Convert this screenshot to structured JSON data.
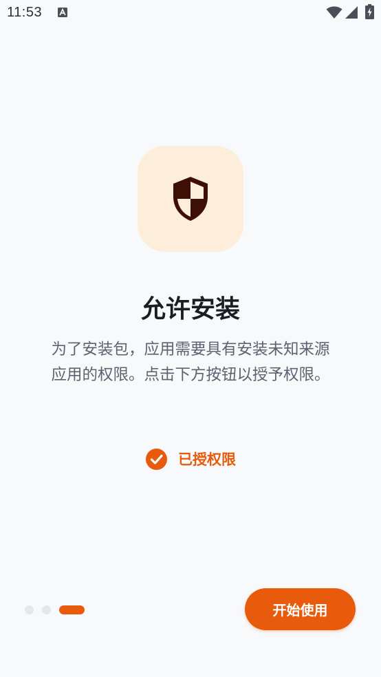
{
  "status_bar": {
    "time": "11:53",
    "icons": [
      "a-notification-icon",
      "wifi-icon",
      "signal-icon",
      "battery-charging-icon"
    ]
  },
  "hero": {
    "icon": "shield-icon",
    "icon_bg_color": "#fdeedb",
    "icon_color": "#3d0f05"
  },
  "title": "允许安装",
  "description": "为了安装包，应用需要具有安装未知来源应用的权限。点击下方按钮以授予权限。",
  "permission_status": {
    "icon": "check-circle-icon",
    "label": "已授权限"
  },
  "pager": {
    "total": 3,
    "active_index": 2
  },
  "start_button": {
    "label": "开始使用"
  },
  "colors": {
    "accent": "#e85a0c",
    "background": "#f8f9fb",
    "title": "#1a1d24",
    "text_muted": "#5b6270"
  }
}
